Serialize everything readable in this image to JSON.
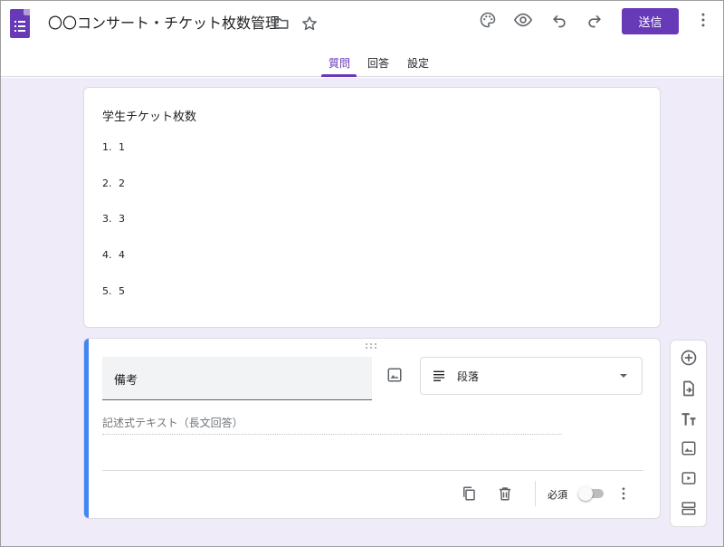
{
  "header": {
    "title": "〇〇コンサート・チケット枚数管理",
    "send_label": "送信",
    "icons": [
      "folder-icon",
      "star-icon",
      "palette-icon",
      "eye-icon",
      "undo-icon",
      "redo-icon",
      "more-vert-icon"
    ]
  },
  "tabs": [
    {
      "label": "質問",
      "active": true
    },
    {
      "label": "回答",
      "active": false
    },
    {
      "label": "設定",
      "active": false
    }
  ],
  "question1": {
    "title": "学生チケット枚数",
    "options": [
      {
        "num": "1.",
        "label": "1"
      },
      {
        "num": "2.",
        "label": "2"
      },
      {
        "num": "3.",
        "label": "3"
      },
      {
        "num": "4.",
        "label": "4"
      },
      {
        "num": "5.",
        "label": "5"
      }
    ]
  },
  "question2": {
    "title_value": "備考",
    "type_label": "段落",
    "answer_hint": "記述式テキスト（長文回答）",
    "required_label": "必須",
    "required": false
  },
  "colors": {
    "accent": "#673ab7",
    "background": "#f0ebf8",
    "focus_bar": "#4285f4"
  }
}
